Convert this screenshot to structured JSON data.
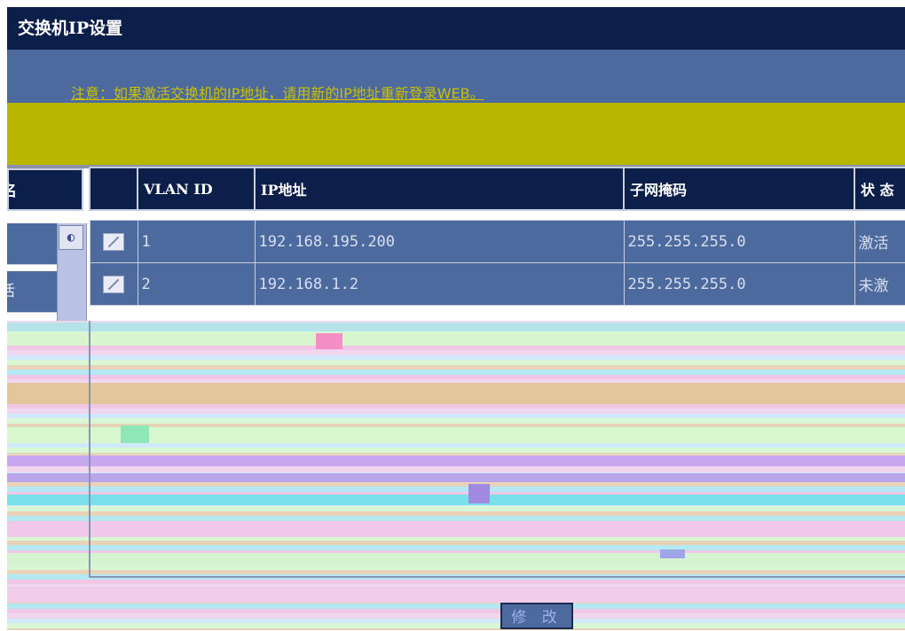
{
  "page_title": "交换机IP设置",
  "notice": "注意：如果激活交换机的IP地址，请用新的IP地址重新登录WEB。",
  "left_table": {
    "header": "名",
    "rows": [
      "",
      "活"
    ]
  },
  "table": {
    "headers": [
      "",
      "VLAN ID",
      "IP地址",
      "子网掩码",
      "状 态"
    ],
    "rows": [
      {
        "vlan_id": "1",
        "ip": "192.168.195.200",
        "mask": "255.255.255.0",
        "status": "激活"
      },
      {
        "vlan_id": "2",
        "ip": "192.168.1.2",
        "mask": "255.255.255.0",
        "status": "未激"
      }
    ]
  },
  "modify_button": "修 改",
  "colors": {
    "header_bg": "#0c1f4a",
    "row_bg": "#4d6a9e",
    "notice_text": "#c9c000",
    "yellow_band": "#b9b600"
  }
}
